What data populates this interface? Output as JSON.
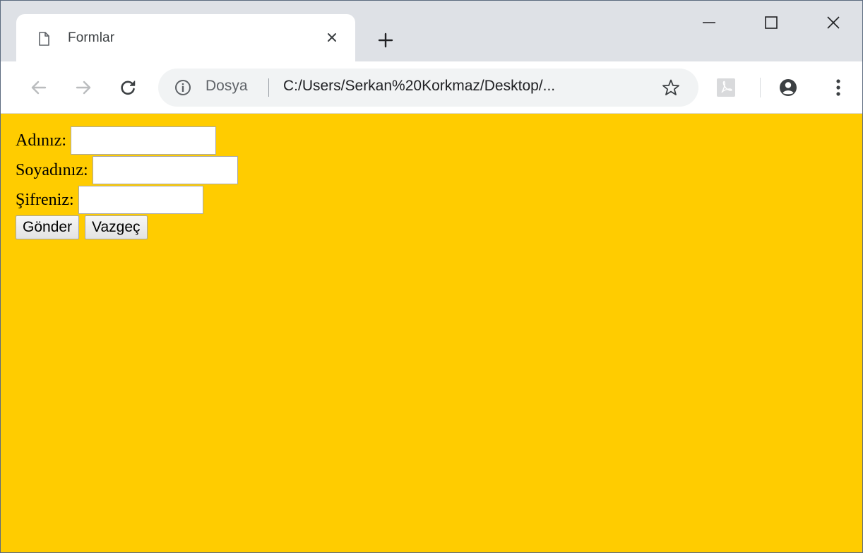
{
  "colors": {
    "page_background": "#ffcc00",
    "tabstrip": "#dee1e6",
    "omnibox": "#f1f3f4"
  },
  "tab": {
    "title": "Formlar",
    "icon": "page-icon",
    "close_icon": "close-icon"
  },
  "window_controls": {
    "minimize_icon": "minimize-icon",
    "maximize_icon": "maximize-icon",
    "close_icon": "close-icon"
  },
  "toolbar": {
    "back_icon": "back-arrow-icon",
    "forward_icon": "forward-arrow-icon",
    "reload_icon": "reload-icon",
    "scheme_chip": "Dosya",
    "url": "C:/Users/Serkan%20Korkmaz/Desktop/...",
    "bookmark_icon": "star-icon",
    "extension_icon": "acrobat-pdf-icon",
    "profile_icon": "account-circle-icon",
    "menu_icon": "kebab-menu-icon"
  },
  "form": {
    "fields": [
      {
        "label": "Adınız:",
        "value": ""
      },
      {
        "label": "Soyadınız:",
        "value": ""
      },
      {
        "label": "Şifreniz:",
        "value": ""
      }
    ],
    "submit_label": "Gönder",
    "reset_label": "Vazgeç"
  }
}
